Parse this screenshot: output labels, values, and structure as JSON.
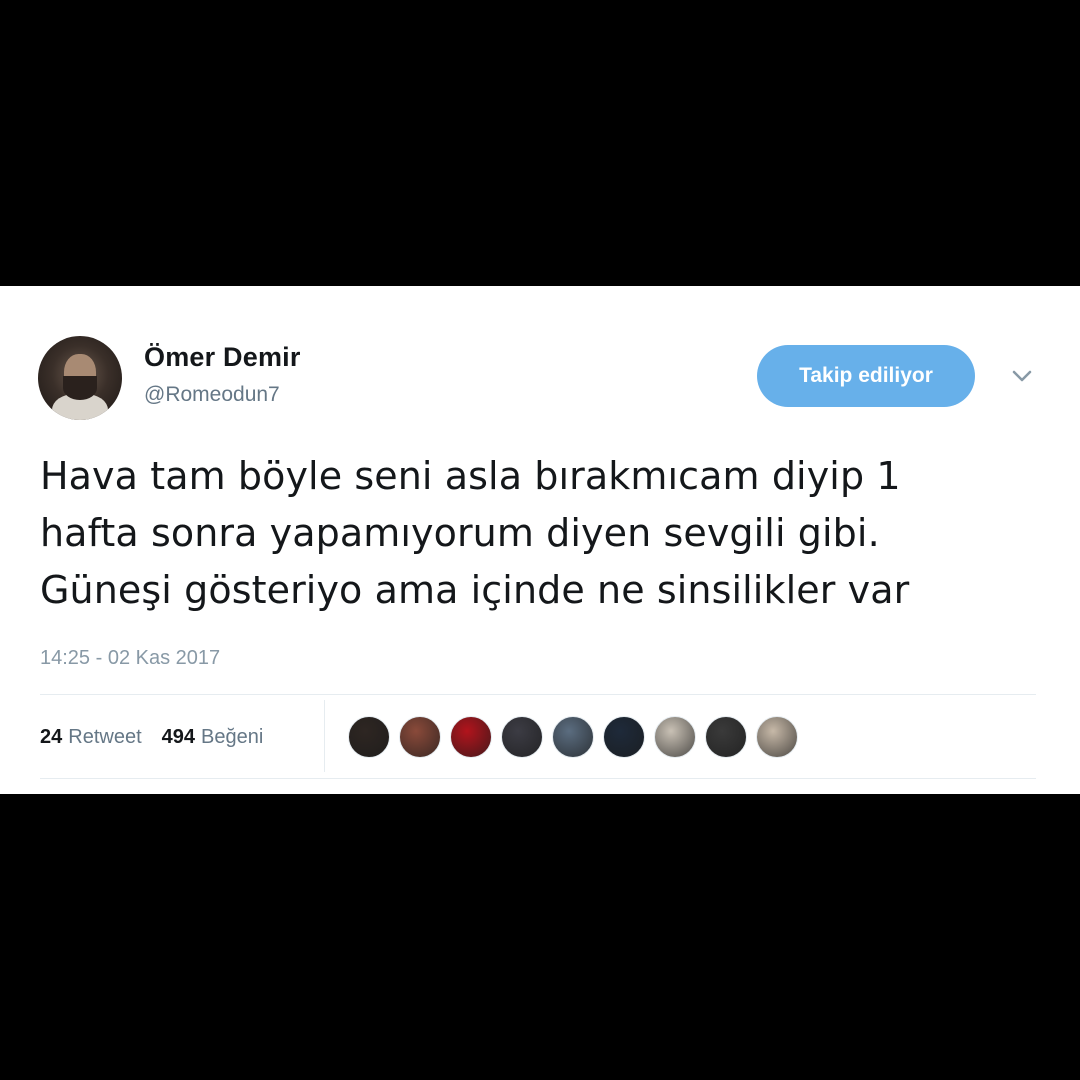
{
  "tweet": {
    "author": {
      "name": "Ömer Demir",
      "handle": "@Romeodun7",
      "avatar_icon": "user-avatar"
    },
    "follow_button_label": "Takip ediliyor",
    "follow_button_color": "#67b0ea",
    "menu_icon": "chevron-down-icon",
    "text": "Hava tam böyle seni asla bırakmıcam diyip 1\nhafta sonra yapamıyorum diyen sevgili gibi.\nGüneşi gösteriyo ama içinde ne sinsilikler var",
    "timestamp": "14:25 - 02 Kas 2017",
    "stats": {
      "retweet_count": "24",
      "retweet_label": "Retweet",
      "like_count": "494",
      "like_label": "Beğeni"
    },
    "likers": [
      {
        "color": "#2e2622"
      },
      {
        "color": "#8a4a3a"
      },
      {
        "color": "#b2141c"
      },
      {
        "color": "#3c3c44"
      },
      {
        "color": "#5b6d80"
      },
      {
        "color": "#1e2a3a"
      },
      {
        "color": "#c9c1b5"
      },
      {
        "color": "#3a3a3a"
      },
      {
        "color": "#c7b9a8"
      }
    ]
  }
}
